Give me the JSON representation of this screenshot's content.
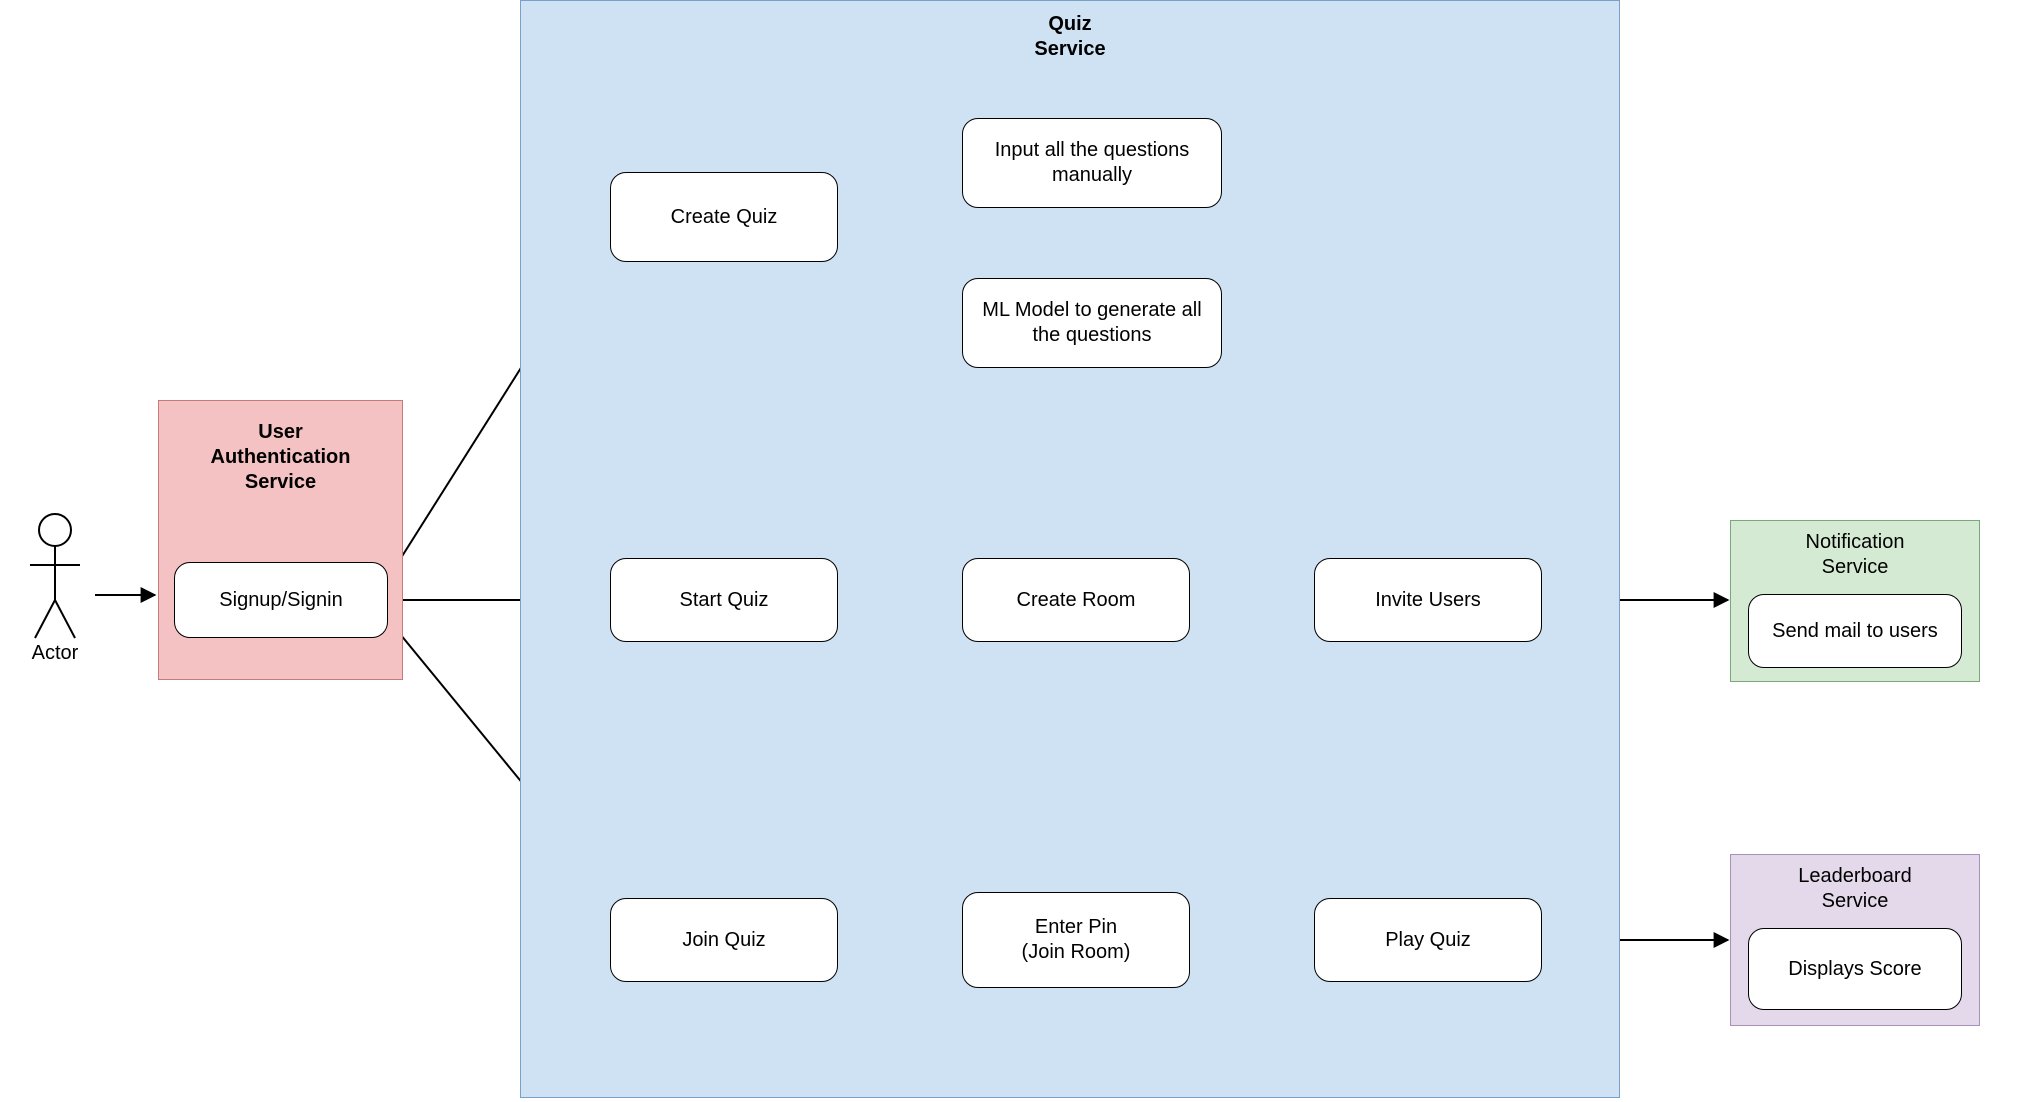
{
  "actor": {
    "label": "Actor"
  },
  "auth": {
    "title": "User\nAuthentication\nService",
    "node": "Signup/Signin",
    "bg": "#f4c2c2",
    "border": "#c97a7a"
  },
  "quiz": {
    "title": "Quiz\nService",
    "bg": "#cfe2f3",
    "border": "#7aa0c9",
    "create": {
      "label": "Create Quiz",
      "manual": "Input all the questions manually",
      "ml": "ML Model to generate all the questions"
    },
    "start": {
      "label": "Start Quiz",
      "room": "Create Room",
      "invite": "Invite Users"
    },
    "join": {
      "label": "Join Quiz",
      "pin": "Enter Pin\n(Join Room)",
      "play": "Play Quiz"
    }
  },
  "notification": {
    "title": "Notification\nService",
    "node": "Send mail to users",
    "bg": "#d5ead3",
    "border": "#7aa87a"
  },
  "leaderboard": {
    "title": "Leaderboard\nService",
    "node": "Displays Score",
    "bg": "#e3d9eb",
    "border": "#a790bb"
  }
}
